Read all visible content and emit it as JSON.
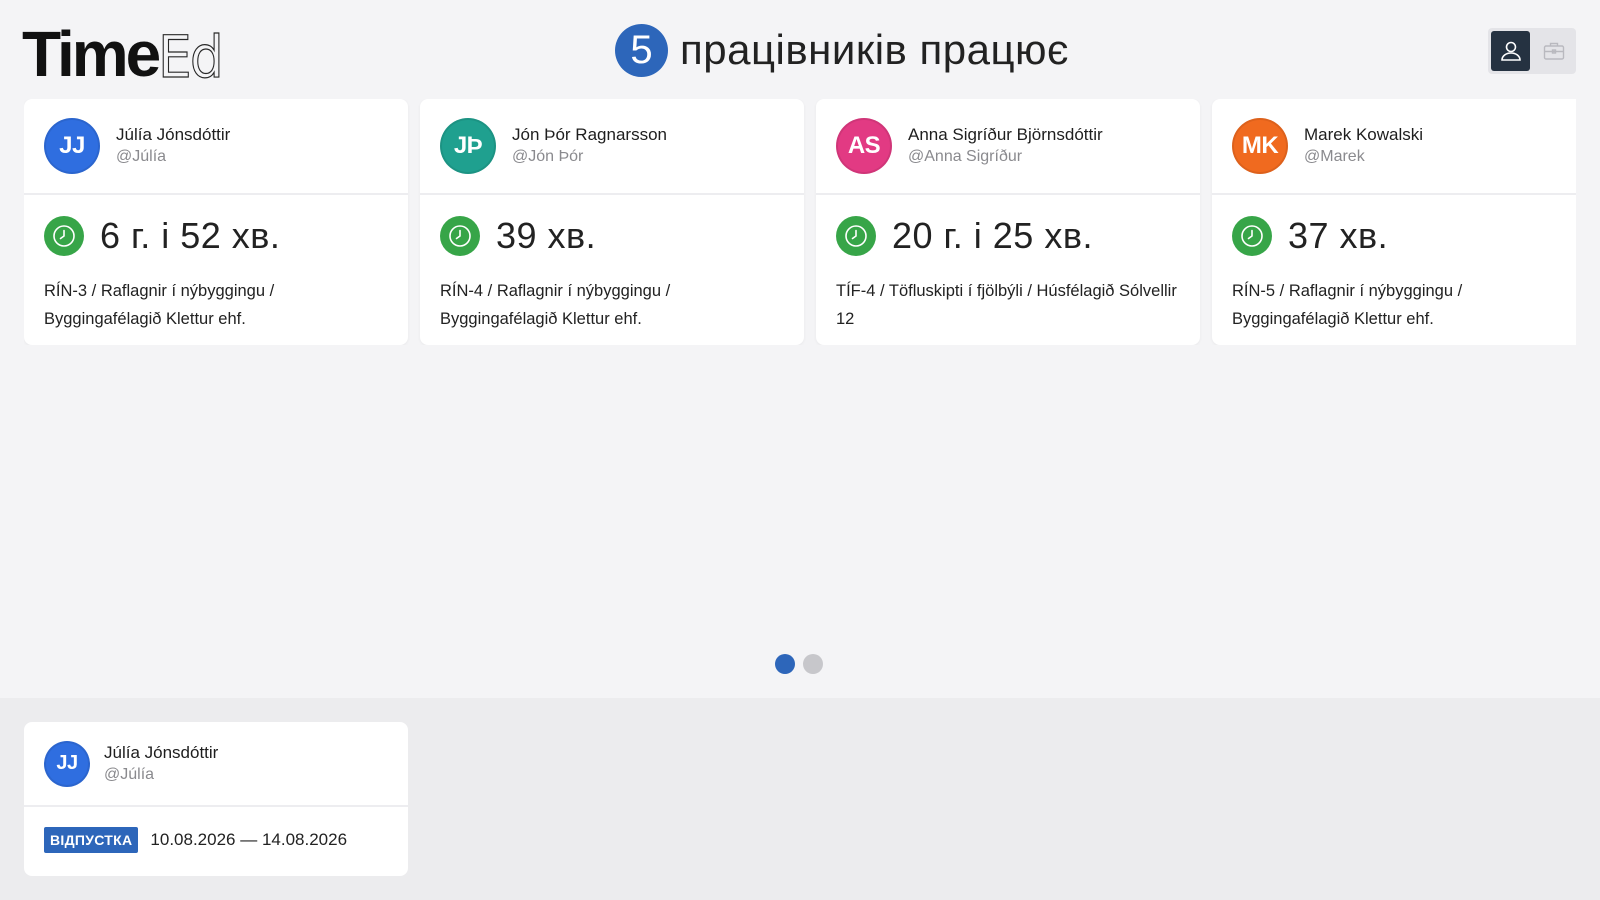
{
  "logo": {
    "bold": "Time",
    "thin": "Ed"
  },
  "header": {
    "count": "5",
    "text": "працівників працює"
  },
  "view_toggle": {
    "options": [
      {
        "icon": "user-icon",
        "active": true
      },
      {
        "icon": "briefcase-icon",
        "active": false
      }
    ]
  },
  "working": [
    {
      "initials": "JJ",
      "color": "#2f6ee0",
      "name": "Júlía Jónsdóttir",
      "handle": "@Júlía",
      "duration": "6 г. і 52 хв.",
      "task": "RÍN-3 / Raflagnir í nýbyggingu / Byggingafélagið Klettur ehf."
    },
    {
      "initials": "JÞ",
      "color": "#1fa08f",
      "name": "Jón Þór Ragnarsson",
      "handle": "@Jón Þór",
      "duration": "39 хв.",
      "task": "RÍN-4 / Raflagnir í nýbyggingu / Byggingafélagið Klettur ehf."
    },
    {
      "initials": "AS",
      "color": "#e23a83",
      "name": "Anna Sigríður Björnsdóttir",
      "handle": "@Anna Sigríður",
      "duration": "20 г. і 25 хв.",
      "task": "TÍF-4 / Töfluskipti í fjölbýli / Húsfélagið Sólvellir 12"
    },
    {
      "initials": "MK",
      "color": "#f06a1f",
      "name": "Marek Kowalski",
      "handle": "@Marek",
      "duration": "37 хв.",
      "task": "RÍN-5 / Raflagnir í nýbyggingu / Byggingafélagið Klettur ehf."
    }
  ],
  "pagination": {
    "pages": 2,
    "current": 1
  },
  "leave": {
    "initials": "JJ",
    "color": "#2f6ee0",
    "name": "Júlía Jónsdóttir",
    "handle": "@Júlía",
    "tag": "ВІДПУСТКА",
    "dates": "10.08.2026 — 14.08.2026"
  },
  "colors": {
    "accent": "#2d66ba",
    "clock": "#37a548",
    "dark": "#253241"
  }
}
